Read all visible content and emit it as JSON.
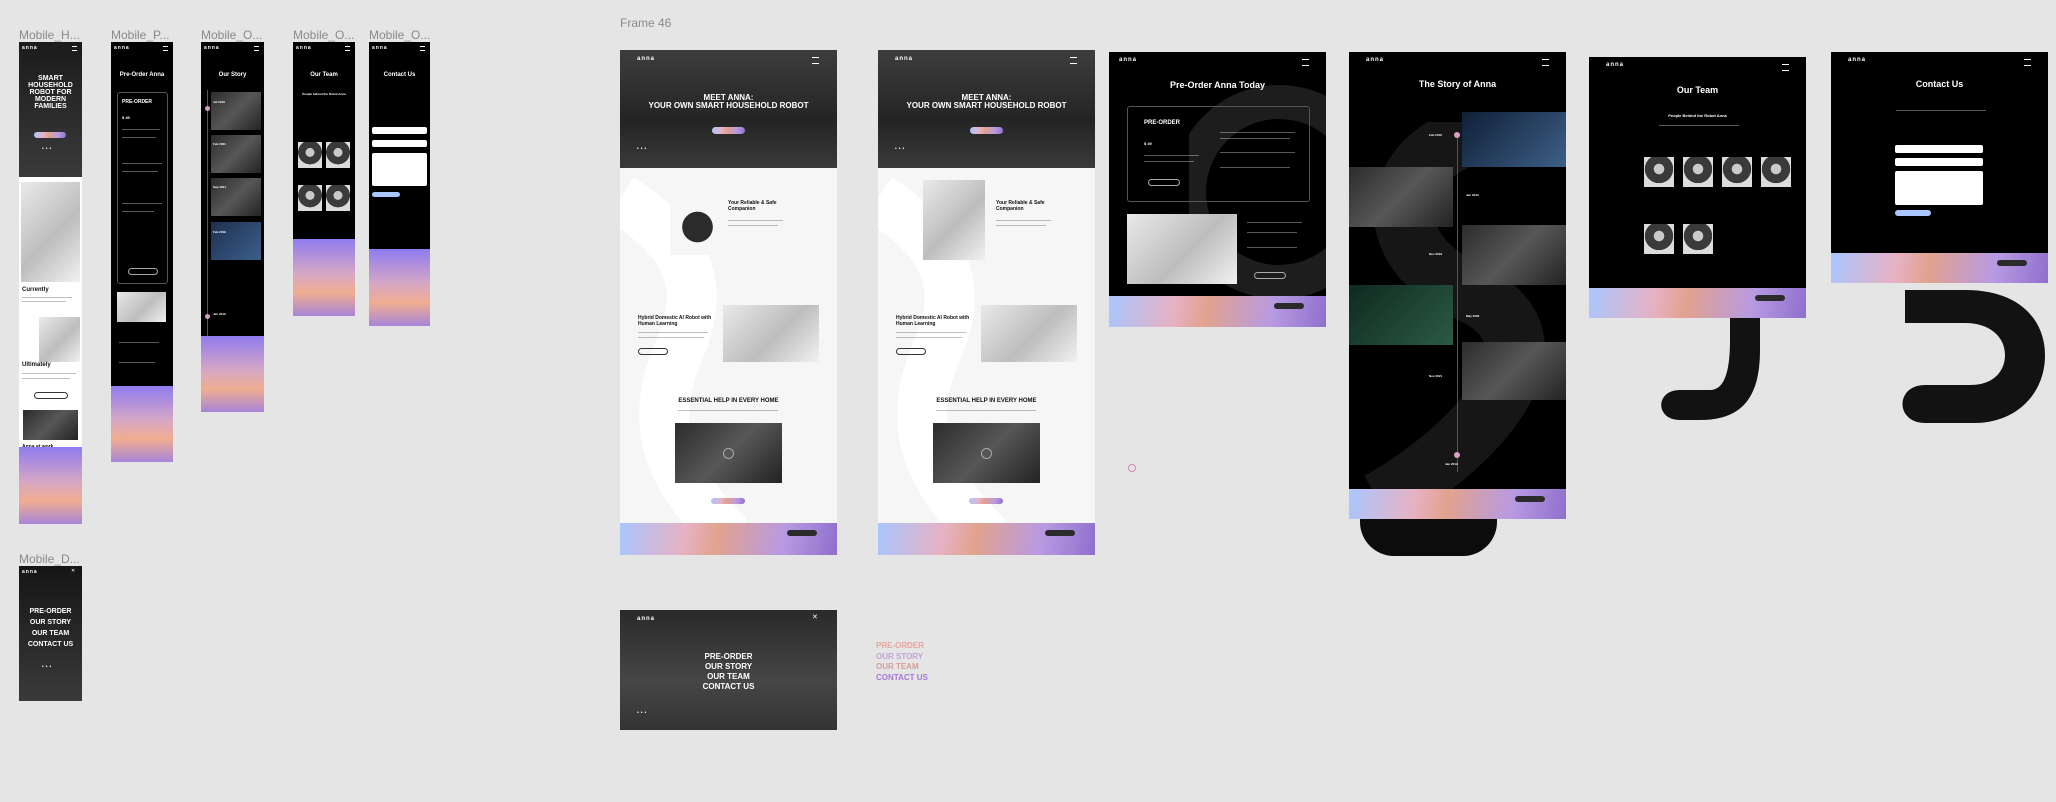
{
  "canvas": {
    "background": "#e5e5e5",
    "accent_gradient": [
      "#a9c6ff",
      "#e2a28e",
      "#8e6fcd"
    ]
  },
  "mobile_labels": [
    "Mobile_H...",
    "Mobile_P...",
    "Mobile_O...",
    "Mobile_O...",
    "Mobile_O...",
    "Mobile_D..."
  ],
  "frame_label": "Frame 46",
  "brand": "anna",
  "mobile_home": {
    "title": "SMART HOUSEHOLD ROBOT FOR MODERN FAMILIES",
    "section_currently": "Currently",
    "section_ultimately": "Ultimately",
    "section_anna_at_work": "Anna at work"
  },
  "mobile_preorder": {
    "title": "Pre-Order Anna",
    "box_title": "PRE-ORDER",
    "price": "$ 49"
  },
  "mobile_story": {
    "title": "Our Story",
    "years": [
      "Jul 2019",
      "Feb 2021",
      "Sep 2021",
      "Feb 2019",
      "Jan 2019"
    ]
  },
  "mobile_team": {
    "title": "Our Team",
    "subtitle": "People behind the Robot Anna"
  },
  "mobile_contact": {
    "title": "Contact Us"
  },
  "mobile_menu": {
    "items": [
      "PRE-ORDER",
      "OUR STORY",
      "OUR TEAM",
      "CONTACT US"
    ]
  },
  "desktop_home": {
    "hero_line1": "MEET ANNA:",
    "hero_line2": "YOUR OWN SMART HOUSEHOLD ROBOT",
    "feature1_title": "Your Reliable & Safe Companion",
    "feature2_title": "Hybrid Domestic AI Robot with Human Learning",
    "section_title": "ESSENTIAL HELP IN EVERY HOME"
  },
  "desktop_preorder": {
    "title": "Pre-Order Anna Today",
    "box_title": "PRE-ORDER",
    "price": "$ 49"
  },
  "desktop_story": {
    "title": "The Story of Anna",
    "years": [
      "Feb 2019",
      "Jan 2019",
      "Dec 2019",
      "May 2020",
      "Nov 2021",
      "Jan 2019"
    ]
  },
  "desktop_team": {
    "title": "Our Team",
    "subtitle": "People Behind the Robot Anna"
  },
  "desktop_contact": {
    "title": "Contact Us"
  },
  "desktop_menu": {
    "items": [
      "PRE-ORDER",
      "OUR STORY",
      "OUR TEAM",
      "CONTACT US"
    ]
  },
  "legend_menu": {
    "items": [
      "PRE-ORDER",
      "OUR STORY",
      "OUR TEAM",
      "CONTACT US"
    ]
  }
}
